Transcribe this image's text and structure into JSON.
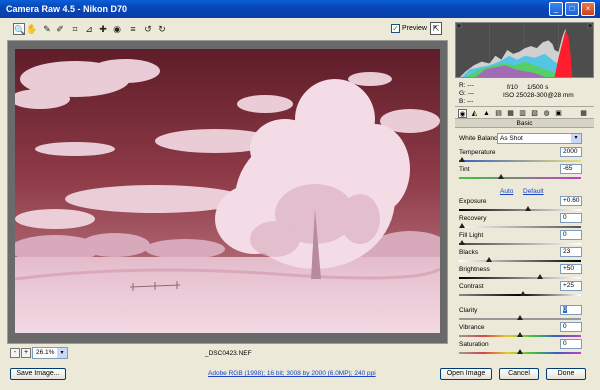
{
  "window": {
    "title": "Camera Raw 4.5  -  Nikon D70",
    "min_glyph": "_",
    "max_glyph": "□",
    "close_glyph": "×"
  },
  "toolbar": {
    "tools": [
      {
        "name": "zoom-tool",
        "icon": "zoom-icon",
        "glyph": "🔍",
        "active": true
      },
      {
        "name": "hand-tool",
        "icon": "hand-icon",
        "glyph": "✋",
        "active": false
      },
      {
        "name": "white-balance-tool",
        "icon": "eyedropper-icon",
        "glyph": "✎",
        "active": false
      },
      {
        "name": "color-sampler-tool",
        "icon": "color-sampler-icon",
        "glyph": "✐",
        "active": false
      },
      {
        "name": "crop-tool",
        "icon": "crop-icon",
        "glyph": "⌗",
        "active": false
      },
      {
        "name": "straighten-tool",
        "icon": "straighten-icon",
        "glyph": "⊿",
        "active": false
      },
      {
        "name": "retouch-tool",
        "icon": "retouch-icon",
        "glyph": "✚",
        "active": false
      },
      {
        "name": "red-eye-tool",
        "icon": "red-eye-icon",
        "glyph": "◉",
        "active": false
      },
      {
        "name": "preferences-tool",
        "icon": "list-icon",
        "glyph": "≡",
        "active": false
      },
      {
        "name": "rotate-left-tool",
        "icon": "rotate-left-icon",
        "glyph": "↺",
        "active": false
      },
      {
        "name": "rotate-right-tool",
        "icon": "rotate-right-icon",
        "glyph": "↻",
        "active": false
      }
    ],
    "preview_label": "Preview",
    "preview_checked": true,
    "check_glyph": "✓",
    "fullscreen_glyph": "⇱"
  },
  "image": {
    "zoom_minus_glyph": "-",
    "zoom_plus_glyph": "+",
    "zoom_value": "26.1%",
    "dropdown_glyph": "▾",
    "filename": "_DSC0423.NEF"
  },
  "readout": {
    "r": "R:  ---",
    "g": "G:  ---",
    "b": "B:  ---",
    "aperture": "f/10",
    "shutter": "1/500 s",
    "iso": "ISO 250",
    "lens": "28-300@28 mm"
  },
  "panel": {
    "tab_glyphs": [
      "◉",
      "◭",
      "▲",
      "▤",
      "▦",
      "▥",
      "▧",
      "◍",
      "▣",
      "▦"
    ],
    "title": "Basic",
    "white_balance_label": "White Balance:",
    "white_balance_value": "As Shot",
    "auto_label": "Auto",
    "default_label": "Default",
    "sliders": [
      {
        "key": "temperature",
        "label": "Temperature",
        "value": "2000",
        "position": 0.0
      },
      {
        "key": "tint",
        "label": "Tint",
        "value": "-65",
        "position": 0.34
      },
      {
        "key": "exposure",
        "label": "Exposure",
        "value": "+0.60",
        "position": 0.57
      },
      {
        "key": "recovery",
        "label": "Recovery",
        "value": "0",
        "position": 0.0
      },
      {
        "key": "fill-light",
        "label": "Fill Light",
        "value": "0",
        "position": 0.0
      },
      {
        "key": "blacks",
        "label": "Blacks",
        "value": "23",
        "position": 0.23
      },
      {
        "key": "brightness",
        "label": "Brightness",
        "value": "+50",
        "position": 0.67
      },
      {
        "key": "contrast",
        "label": "Contrast",
        "value": "+25",
        "position": 0.53
      },
      {
        "key": "clarity",
        "label": "Clarity",
        "value": "0",
        "position": 0.5
      },
      {
        "key": "vibrance",
        "label": "Vibrance",
        "value": "0",
        "position": 0.5
      },
      {
        "key": "saturation",
        "label": "Saturation",
        "value": "0",
        "position": 0.5
      }
    ]
  },
  "footer": {
    "save_label": "Save Image...",
    "workflow_label": "Adobe RGB (1998); 16 bit; 3008 by 2000 (6.0MP); 240 ppi",
    "open_label": "Open Image",
    "cancel_label": "Cancel",
    "done_label": "Done"
  },
  "colors": {
    "title_bar": "#0a5fd8",
    "sky": "#7e2f3c",
    "foliage": "#e9c6d4",
    "histogram_bg": "#4d4d4d",
    "highlight": "#316ac5"
  }
}
